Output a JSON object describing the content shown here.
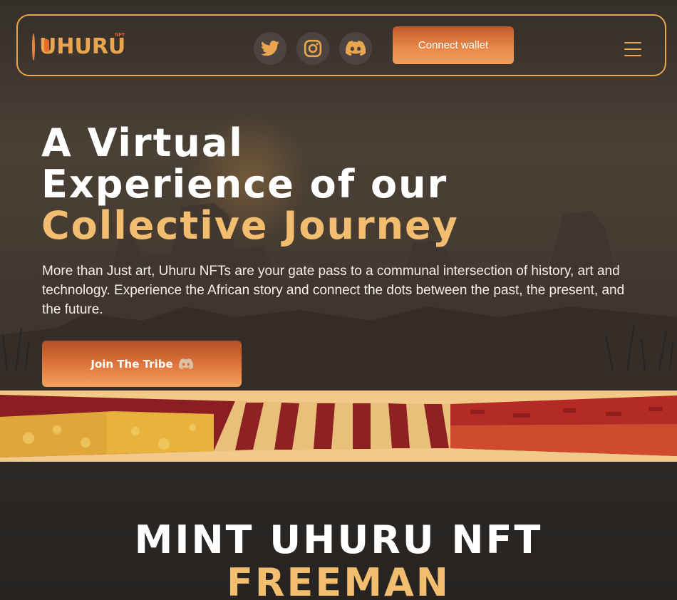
{
  "brand": {
    "logo_text": "UHURU",
    "logo_badge": "NFT",
    "accent_color": "#e9a64e",
    "gold_color": "#f2bd6e"
  },
  "nav": {
    "social": [
      {
        "name": "twitter-icon"
      },
      {
        "name": "instagram-icon"
      },
      {
        "name": "discord-icon"
      }
    ],
    "connect_label": "Connect wallet",
    "menu_icon": "hamburger-menu-icon"
  },
  "hero": {
    "headline_line1": "A Virtual",
    "headline_line2": "Experience of our",
    "headline_line3": "Collective Journey",
    "description": "More than Just art, Uhuru NFTs are your gate pass to a communal intersection of history, art and technology. Experience the African story and connect the dots between the past, the present, and the future.",
    "cta_label": "Join The Tribe",
    "cta_icon": "discord-icon"
  },
  "mint": {
    "title_line1": "MINT UHURU NFT",
    "title_line2": "FREEMAN"
  }
}
